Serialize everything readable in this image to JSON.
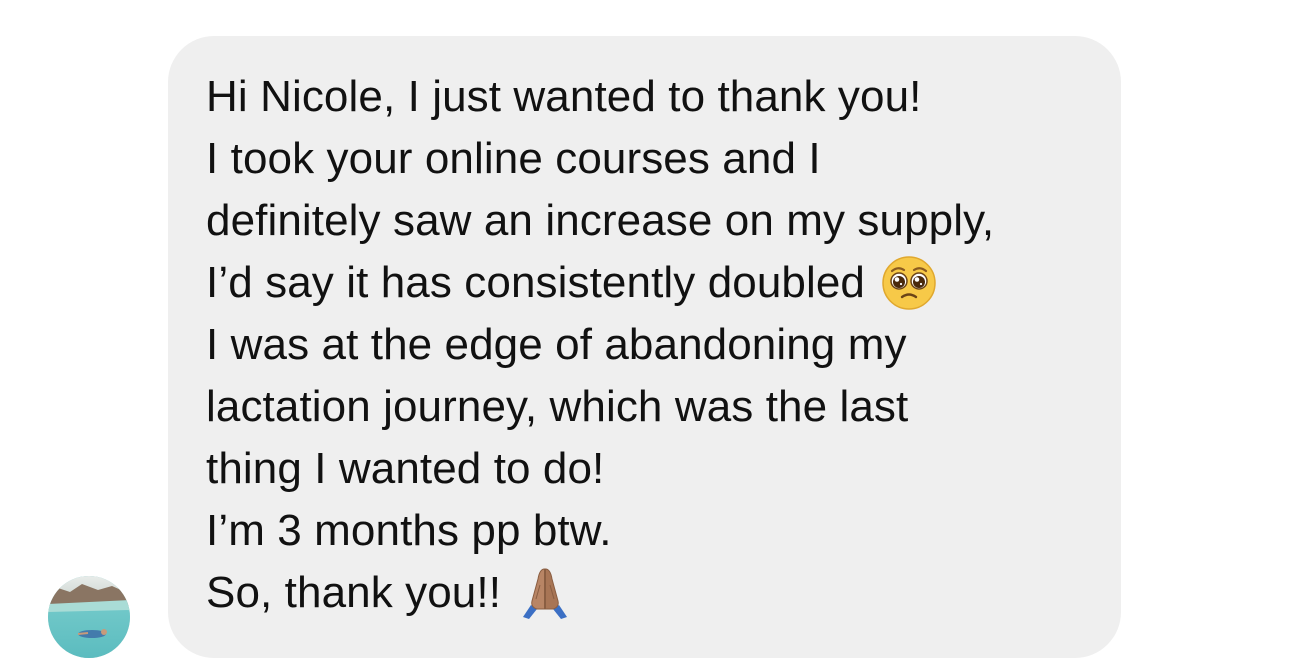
{
  "message": {
    "lines": [
      "Hi Nicole, I just wanted to thank you!",
      "I took your online courses and I",
      "definitely saw an increase on my supply,",
      "I’d say it has consistently doubled",
      "I was at the edge of abandoning my",
      "lactation journey, which was the last",
      "thing I wanted to do!",
      "I’m 3 months pp btw.",
      "So, thank you!!"
    ],
    "emojis": {
      "line_4": "pleading-face-icon",
      "line_9": "folded-hands-icon"
    }
  },
  "sender": {
    "avatar": "beach-swimmer-avatar"
  },
  "colors": {
    "bubble": "#efefef",
    "text": "#111111",
    "background": "#ffffff"
  }
}
